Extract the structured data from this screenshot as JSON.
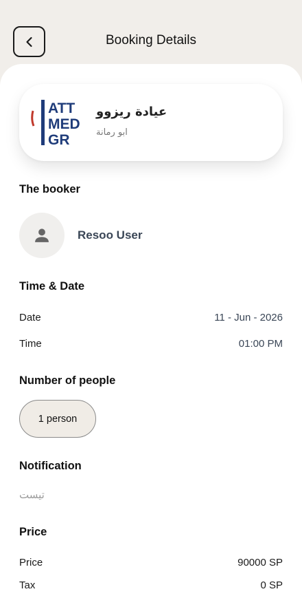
{
  "header": {
    "title": "Booking Details",
    "back_icon": "chevron-left-icon"
  },
  "clinic": {
    "name": "عيادة ريزوو",
    "location": "ابو رمانة",
    "logo_lines": [
      "ATT",
      "MED",
      "GR"
    ],
    "logo_color": "#1f3c7a",
    "logo_accent": "#c0392b"
  },
  "booker": {
    "title": "The booker",
    "name": "Resoo User",
    "avatar_icon": "person-icon"
  },
  "time_date": {
    "title": "Time & Date",
    "date_label": "Date",
    "date_value": "11 - Jun - 2026",
    "time_label": "Time",
    "time_value": "01:00 PM"
  },
  "people": {
    "title": "Number of people",
    "value": "1 person"
  },
  "notification": {
    "title": "Notification",
    "text": "تيست"
  },
  "price": {
    "title": "Price",
    "price_label": "Price",
    "price_value": "90000 SP",
    "tax_label": "Tax",
    "tax_value": "0 SP"
  }
}
